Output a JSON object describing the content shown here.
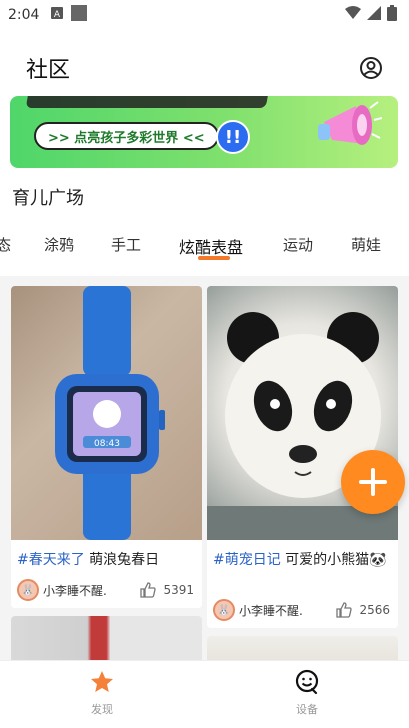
{
  "status_bar": {
    "time": "2:04"
  },
  "header": {
    "title": "社区"
  },
  "banner": {
    "pill_text": ">> 点亮孩子多彩世界 <<",
    "badge_text": "!!"
  },
  "section": {
    "title": "育儿广场"
  },
  "tabs": [
    {
      "label": "态"
    },
    {
      "label": "涂鸦"
    },
    {
      "label": "手工"
    },
    {
      "label": "炫酷表盘",
      "active": true
    },
    {
      "label": "运动"
    },
    {
      "label": "萌娃"
    }
  ],
  "cards": [
    {
      "tag": "#春天来了",
      "text": " 萌浪兔春日",
      "author": "小李睡不醒.",
      "likes": "5391",
      "image": "smartwatch-photo"
    },
    {
      "tag": "#萌宠日记",
      "text": " 可爱的小熊猫🐼",
      "author": "小李睡不醒.",
      "likes": "2566",
      "image": "panda-photo"
    }
  ],
  "bottom_nav": [
    {
      "label": "发现",
      "icon": "star-icon",
      "active": true
    },
    {
      "label": "设备",
      "icon": "smile-face-icon",
      "active": false
    }
  ],
  "colors": {
    "accent": "#f27a2a",
    "tag_blue": "#2b64c7",
    "fab": "#ff8a1f"
  }
}
